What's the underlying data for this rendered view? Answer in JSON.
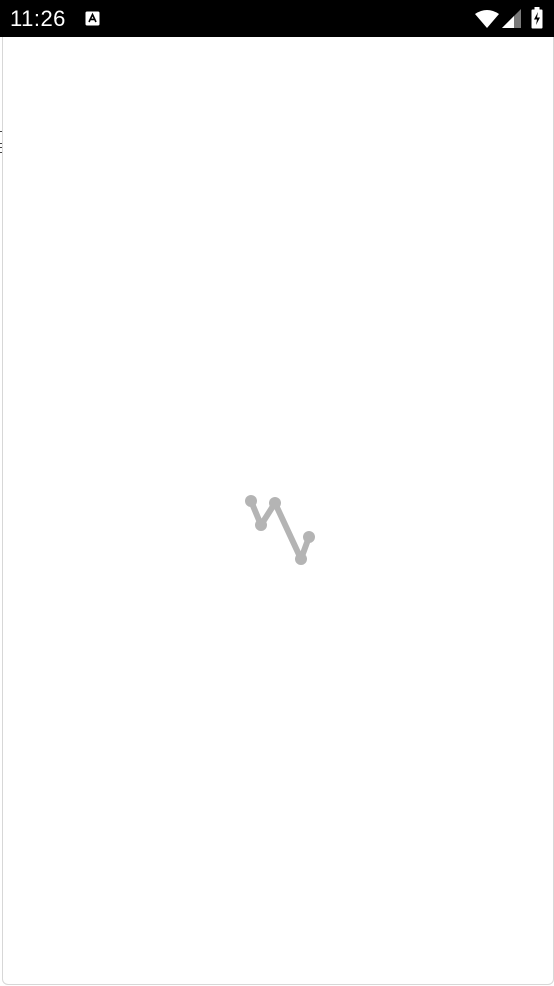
{
  "status_bar": {
    "time": "11:26",
    "notification_icon": "app-notification-icon",
    "icons": [
      "wifi-icon",
      "cellular-signal-icon",
      "battery-charging-icon"
    ],
    "background": "#000000",
    "foreground": "#ffffff"
  },
  "content": {
    "loading_indicator": "loading-spinner",
    "indicator_color": "#b4b4b4"
  }
}
